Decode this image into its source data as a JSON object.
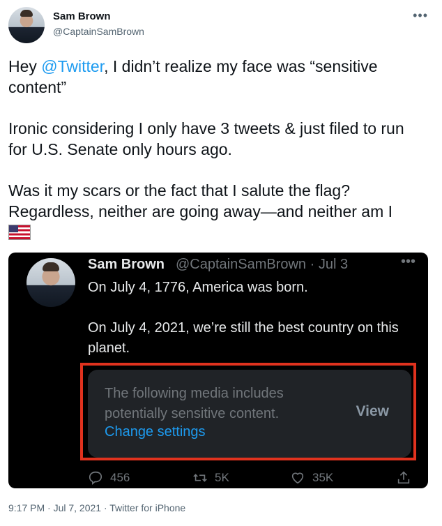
{
  "author": {
    "display_name": "Sam Brown",
    "handle": "@CaptainSamBrown"
  },
  "tweet": {
    "line1_prefix": "Hey ",
    "mention": "@Twitter",
    "line1_suffix": ", I didn’t realize my face was “sensitive content”",
    "para2": "Ironic considering I only have 3 tweets & just filed to run for U.S. Senate only hours ago.",
    "para3": "Was it my scars or the fact that I salute the flag? Regardless, neither are going away—and neither am I",
    "flag_icon": "us-flag-emoji"
  },
  "quoted": {
    "display_name": "Sam Brown",
    "meta": "@CaptainSamBrown · Jul 3",
    "para1": "On July 4, 1776, America was born.",
    "para2": "On July 4, 2021, we’re still the best country on this planet.",
    "sensitive_line1": "The following media includes",
    "sensitive_line2": "potentially sensitive content.",
    "change_settings": "Change settings",
    "view_label": "View",
    "replies": "456",
    "retweets": "5K",
    "likes": "35K"
  },
  "footer": "9:17 PM · Jul 7, 2021 · Twitter for iPhone",
  "colors": {
    "accent": "#1d9bf0",
    "highlight": "#e0321e"
  }
}
